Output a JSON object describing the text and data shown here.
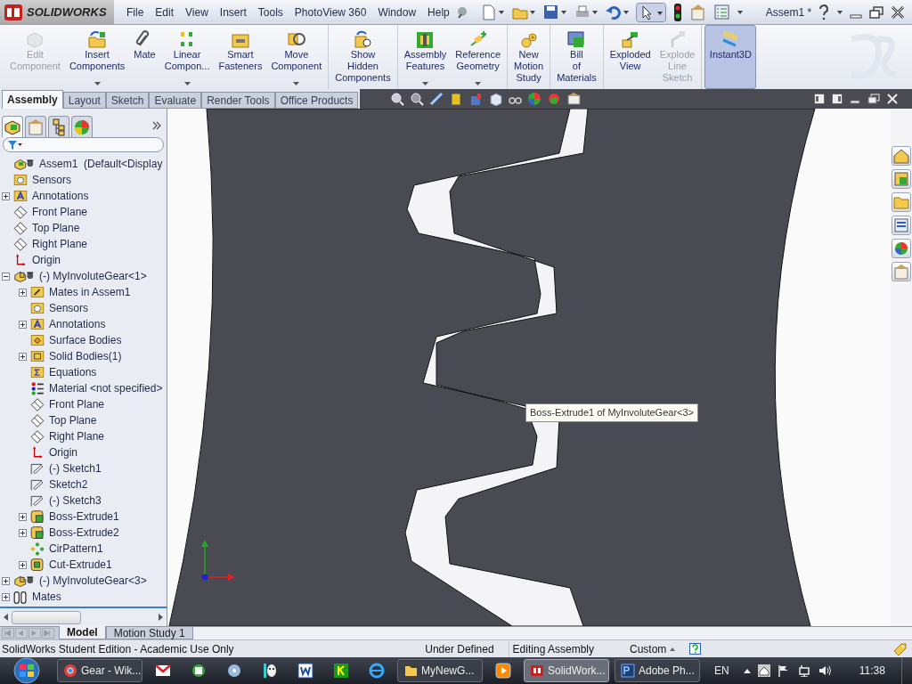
{
  "app": {
    "logo": "SOLIDWORKS",
    "menu": [
      "File",
      "Edit",
      "View",
      "Insert",
      "Tools",
      "PhotoView 360",
      "Window",
      "Help"
    ],
    "document_title": "Assem1 *"
  },
  "command_groups": [
    [
      {
        "label": "Edit Component",
        "disabled": true,
        "dropdown": false,
        "selected": false
      },
      {
        "label": "Insert Components",
        "disabled": false,
        "dropdown": true,
        "selected": false
      },
      {
        "label": "Mate",
        "disabled": false,
        "dropdown": false,
        "selected": false
      },
      {
        "label": "Linear Compon...",
        "disabled": false,
        "dropdown": true,
        "selected": false
      },
      {
        "label": "Smart Fasteners",
        "disabled": false,
        "dropdown": false,
        "selected": false
      },
      {
        "label": "Move Component",
        "disabled": false,
        "dropdown": true,
        "selected": false
      }
    ],
    [
      {
        "label": "Show Hidden Components",
        "disabled": false,
        "dropdown": false,
        "selected": false
      }
    ],
    [
      {
        "label": "Assembly Features",
        "disabled": false,
        "dropdown": true,
        "selected": false
      },
      {
        "label": "Reference Geometry",
        "disabled": false,
        "dropdown": true,
        "selected": false
      }
    ],
    [
      {
        "label": "New Motion Study",
        "disabled": false,
        "dropdown": false,
        "selected": false
      }
    ],
    [
      {
        "label": "Bill of Materials",
        "disabled": false,
        "dropdown": false,
        "selected": false
      }
    ],
    [
      {
        "label": "Exploded View",
        "disabled": false,
        "dropdown": false,
        "selected": false
      },
      {
        "label": "Explode Line Sketch",
        "disabled": true,
        "dropdown": false,
        "selected": false
      }
    ],
    [
      {
        "label": "Instant3D",
        "disabled": false,
        "dropdown": false,
        "selected": true
      }
    ]
  ],
  "command_tabs": [
    {
      "label": "Assembly",
      "selected": true
    },
    {
      "label": "Layout",
      "selected": false
    },
    {
      "label": "Sketch",
      "selected": false
    },
    {
      "label": "Evaluate",
      "selected": false
    },
    {
      "label": "Render Tools",
      "selected": false
    },
    {
      "label": "Office Products",
      "selected": false
    }
  ],
  "feature_tree": [
    {
      "label": "Assem1  (Default<Display",
      "kind": "assembly"
    },
    {
      "label": "Sensors",
      "kind": "sensor"
    },
    {
      "label": "Annotations",
      "kind": "annotation",
      "expanded": false
    },
    {
      "label": "Front Plane",
      "kind": "plane"
    },
    {
      "label": "Top Plane",
      "kind": "plane"
    },
    {
      "label": "Right Plane",
      "kind": "plane"
    },
    {
      "label": "Origin",
      "kind": "origin"
    },
    {
      "label": "(-) MyInvoluteGear<1>",
      "kind": "part",
      "expanded": true,
      "children": [
        {
          "label": "Mates in Assem1",
          "kind": "mates",
          "expanded": false
        },
        {
          "label": "Sensors",
          "kind": "sensor"
        },
        {
          "label": "Annotations",
          "kind": "annotation",
          "expanded": false
        },
        {
          "label": "Surface Bodies",
          "kind": "surface"
        },
        {
          "label": "Solid Bodies(1)",
          "kind": "solid",
          "expanded": false
        },
        {
          "label": "Equations",
          "kind": "equation"
        },
        {
          "label": "Material <not specified>",
          "kind": "material"
        },
        {
          "label": "Front Plane",
          "kind": "plane"
        },
        {
          "label": "Top Plane",
          "kind": "plane"
        },
        {
          "label": "Right Plane",
          "kind": "plane"
        },
        {
          "label": "Origin",
          "kind": "origin"
        },
        {
          "label": "(-) Sketch1",
          "kind": "sketch"
        },
        {
          "label": "Sketch2",
          "kind": "sketch"
        },
        {
          "label": "(-) Sketch3",
          "kind": "sketch"
        },
        {
          "label": "Boss-Extrude1",
          "kind": "extrude",
          "expanded": false
        },
        {
          "label": "Boss-Extrude2",
          "kind": "extrude",
          "expanded": false
        },
        {
          "label": "CirPattern1",
          "kind": "pattern"
        },
        {
          "label": "Cut-Extrude1",
          "kind": "cut",
          "expanded": false
        }
      ]
    },
    {
      "label": "(-) MyInvoluteGear<3>",
      "kind": "part",
      "expanded": false
    },
    {
      "label": "Mates",
      "kind": "matesgroup",
      "expanded": false
    }
  ],
  "panel_tabs": [
    {
      "selected": true
    },
    {
      "selected": false
    },
    {
      "selected": false
    },
    {
      "selected": false
    }
  ],
  "tooltip": "Boss-Extrude1 of MyInvoluteGear<3>",
  "bottom_tabs": [
    {
      "label": "Model",
      "selected": true
    },
    {
      "label": "Motion Study 1",
      "selected": false
    }
  ],
  "status_bar": {
    "message": "SolidWorks Student Edition - Academic Use Only",
    "state": "Under Defined",
    "mode": "Editing Assembly",
    "units": "Custom"
  },
  "taskbar": {
    "items": [
      {
        "kind": "window",
        "label": "Gear - Wik...",
        "selected": false
      },
      {
        "kind": "pin"
      },
      {
        "kind": "pin"
      },
      {
        "kind": "pin"
      },
      {
        "kind": "pin"
      },
      {
        "kind": "pin"
      },
      {
        "kind": "pin"
      },
      {
        "kind": "pin"
      },
      {
        "kind": "window",
        "label": "MyNewG...",
        "selected": false
      },
      {
        "kind": "pin"
      },
      {
        "kind": "window",
        "label": "SolidWork...",
        "selected": true
      },
      {
        "kind": "window",
        "label": "Adobe Ph...",
        "selected": false
      }
    ],
    "language": "EN",
    "clock": "11:38"
  }
}
